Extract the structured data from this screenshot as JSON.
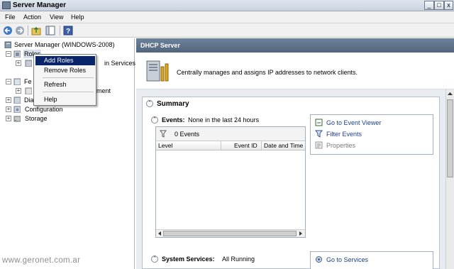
{
  "window": {
    "title": "Server Manager",
    "controls": [
      "_",
      "□",
      "x"
    ]
  },
  "menu": [
    "File",
    "Action",
    "View",
    "Help"
  ],
  "toolbar": {
    "icons": [
      "back-arrow-icon",
      "forward-arrow-icon",
      "up-folder-icon",
      "show-hide-tree-icon",
      "help-icon"
    ]
  },
  "tree": {
    "root": "Server Manager (WINDOWS-2008)",
    "items": [
      {
        "label": "Roles",
        "expander": "−",
        "selected": true
      },
      {
        "label": "in Services",
        "expander": "+"
      },
      {
        "label": "Fe",
        "expander": "−"
      },
      {
        "label": "ment",
        "expander": "+"
      },
      {
        "label": "Dia",
        "expander": "+"
      },
      {
        "label": "Configuration",
        "expander": "+"
      },
      {
        "label": "Storage",
        "expander": "+"
      }
    ]
  },
  "context_menu": {
    "items": [
      "Add Roles",
      "Remove Roles",
      "Refresh",
      "Help"
    ],
    "highlighted": "Add Roles"
  },
  "right": {
    "header": "DHCP Server",
    "description": "Centrally manages and assigns IP addresses to network clients.",
    "summary": {
      "title": "Summary",
      "events": {
        "label": "Events:",
        "value": "None in the last 24 hours",
        "count": "0 Events",
        "columns": [
          "Level",
          "Event ID",
          "Date and Time"
        ]
      },
      "event_links": [
        {
          "label": "Go to Event Viewer",
          "enabled": true
        },
        {
          "label": "Filter Events",
          "enabled": true
        },
        {
          "label": "Properties",
          "enabled": false
        }
      ],
      "services": {
        "label": "System Services:",
        "value": "All Running"
      },
      "service_links": [
        {
          "label": "Go to Services",
          "enabled": true
        }
      ]
    }
  },
  "watermark": "www.geronet.com.ar",
  "colors": {
    "header": "#5b6f87",
    "selection": "#0a246a",
    "link": "#1a3f8c",
    "content_bg": "#e8ecf1"
  }
}
